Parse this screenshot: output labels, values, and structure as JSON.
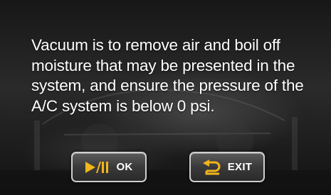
{
  "dialog": {
    "message": "Vacuum is to remove air and boil off moisture that may be presented in the system, and ensure the pressure of the A/C system is below 0 psi."
  },
  "buttons": {
    "ok": {
      "label": "OK",
      "icon": "play-pause-icon"
    },
    "exit": {
      "label": "EXIT",
      "icon": "return-arrow-icon"
    }
  },
  "colors": {
    "icon_accent": "#f2b51c",
    "text": "#ffffff",
    "button_border": "#cfcfcf"
  }
}
